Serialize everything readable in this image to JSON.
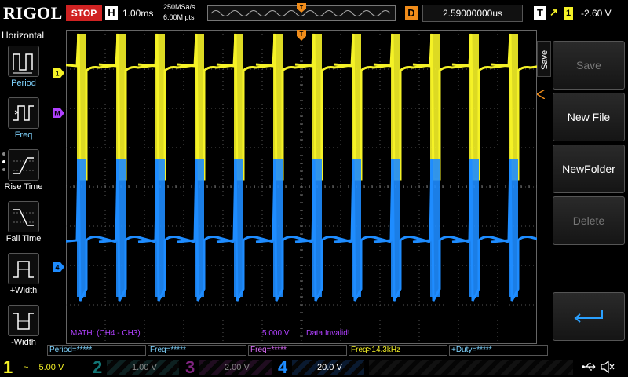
{
  "top": {
    "brand": "RIGOL",
    "run_state": "STOP",
    "horizontal_letter": "H",
    "timebase": "1.00ms",
    "sample_rate": "250MSa/s",
    "memory_depth": "6.00M pts",
    "delay_letter": "D",
    "delay_value": "2.59000000us",
    "trigger_letter": "T",
    "trigger_source": "1",
    "trigger_level": "-2.60 V"
  },
  "left_panel": {
    "title": "Horizontal",
    "items": [
      {
        "label": "Period"
      },
      {
        "label": "Freq"
      },
      {
        "label": "Rise Time"
      },
      {
        "label": "Fall Time"
      },
      {
        "label": "+Width"
      },
      {
        "label": "-Width"
      }
    ]
  },
  "markers": {
    "ch1": "1",
    "math": "M",
    "ch4": "4",
    "trigger": "T"
  },
  "math": {
    "label": "MATH: (CH4 - CH3)",
    "scale": "5.000 V",
    "status": "Data Invalid!"
  },
  "measurements": [
    {
      "text": "Period=*****",
      "color": "#7fd4ff"
    },
    {
      "text": "Freq=*****",
      "color": "#7fd4ff"
    },
    {
      "text": "Freq=*****",
      "color": "#e070ff"
    },
    {
      "text": "Freq>14.3kHz",
      "color": "#f5f227"
    },
    {
      "text": "+Duty=*****",
      "color": "#7fd4ff"
    }
  ],
  "right_menu": {
    "tab_label": "Save",
    "buttons": [
      {
        "label": "Save",
        "enabled": false
      },
      {
        "label": "New File",
        "enabled": true
      },
      {
        "label": "NewFolder",
        "enabled": true
      },
      {
        "label": "Delete",
        "enabled": false
      }
    ]
  },
  "channels": [
    {
      "number": "1",
      "coupling": "~",
      "scale": "5.00 V",
      "color": "#f5f227",
      "active": true
    },
    {
      "number": "2",
      "coupling": "",
      "scale": "1.00 V",
      "color": "#1fc4c4",
      "active": false
    },
    {
      "number": "3",
      "coupling": "",
      "scale": "2.00 V",
      "color": "#d23cd2",
      "active": false
    },
    {
      "number": "4",
      "coupling": "",
      "scale": "20.0 V",
      "color": "#1e8cff",
      "active": true
    }
  ],
  "colors": {
    "ch1": "#f5f227",
    "ch4": "#1e8cff",
    "math": "#b040ff",
    "trigger": "#f08c1a",
    "grid": "#555555"
  },
  "waveform": {
    "pulse_count": 12
  }
}
